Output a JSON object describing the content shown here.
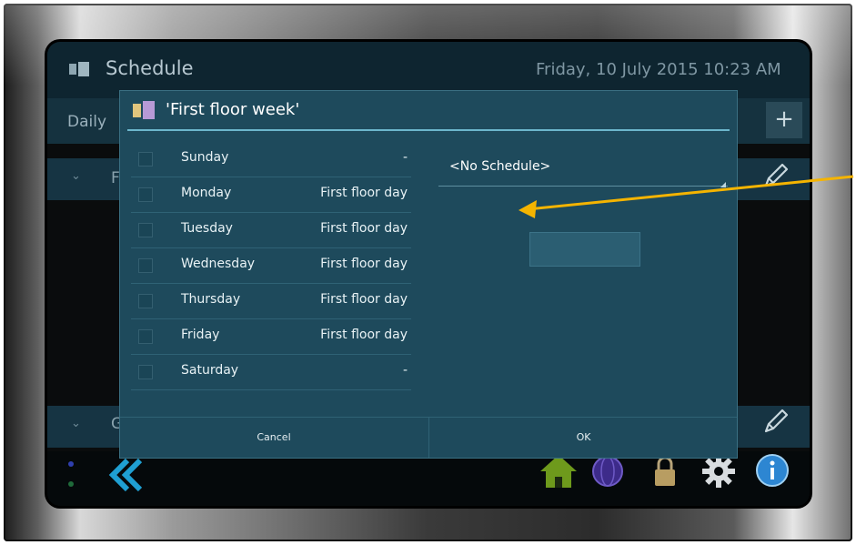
{
  "app": {
    "title": "Schedule",
    "datetime": "Friday, 10 July 2015 10:23 AM",
    "tab_daily": "Daily",
    "add_button": "+",
    "row1_letter": "F",
    "row2_letter": "G"
  },
  "dialog": {
    "title": "'First floor week'",
    "days": [
      {
        "name": "Sunday",
        "schedule": "-"
      },
      {
        "name": "Monday",
        "schedule": "First floor day"
      },
      {
        "name": "Tuesday",
        "schedule": "First floor day"
      },
      {
        "name": "Wednesday",
        "schedule": "First floor day"
      },
      {
        "name": "Thursday",
        "schedule": "First floor day"
      },
      {
        "name": "Friday",
        "schedule": "First floor day"
      },
      {
        "name": "Saturday",
        "schedule": "-"
      }
    ],
    "schedule_select": "<No Schedule>",
    "cancel_label": "Cancel",
    "ok_label": "OK"
  },
  "colors": {
    "dialog_bg": "#1e4a5c",
    "accent": "#6cb6cc",
    "annotation_arrow": "#f5b400"
  }
}
